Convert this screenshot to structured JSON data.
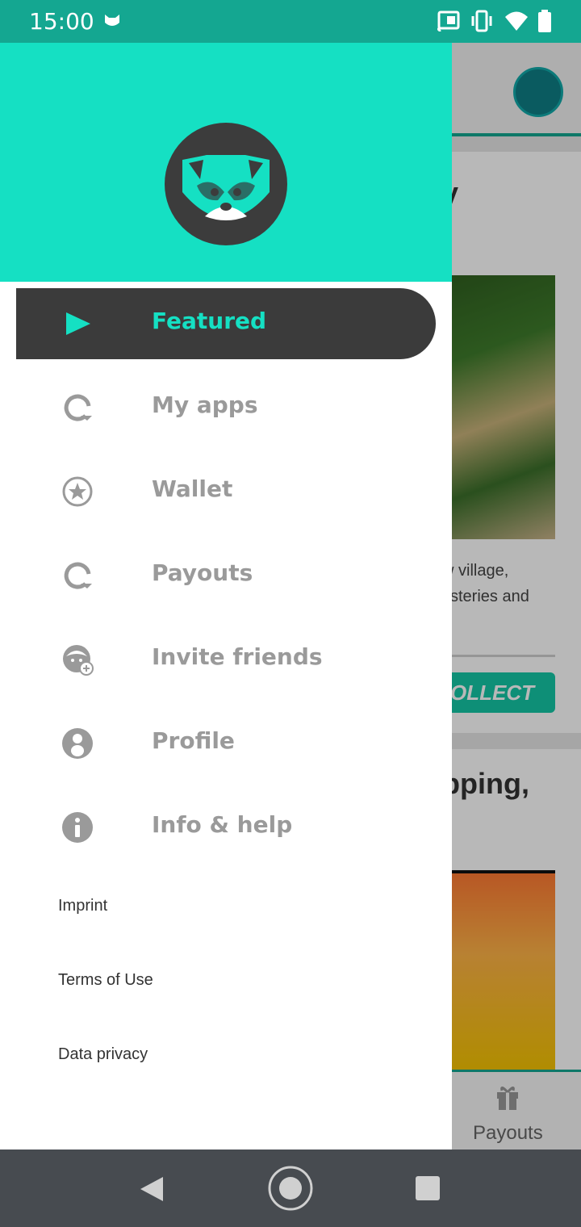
{
  "status_bar": {
    "time": "15:00"
  },
  "background": {
    "title_fragment_1": "y",
    "description_line_1": "w village,",
    "description_line_2": "ysteries and",
    "collect_button": "OLLECT",
    "title_fragment_2": "pping,",
    "bottom_tab_label": "Payouts"
  },
  "drawer": {
    "menu": [
      {
        "label": "Featured",
        "icon": "play-icon",
        "active": true
      },
      {
        "label": "My apps",
        "icon": "refresh-icon"
      },
      {
        "label": "Wallet",
        "icon": "star-circle-icon"
      },
      {
        "label": "Payouts",
        "icon": "refresh-icon"
      },
      {
        "label": "Invite friends",
        "icon": "face-plus-icon"
      },
      {
        "label": "Profile",
        "icon": "person-circle-icon"
      },
      {
        "label": "Info & help",
        "icon": "info-icon"
      }
    ],
    "links": [
      "Imprint",
      "Terms of Use",
      "Data privacy"
    ]
  },
  "colors": {
    "accent": "#15e0c3",
    "status_bar": "#14a791",
    "active_item_bg": "#3b3b3b",
    "inactive_text": "#9a9a9a",
    "nav_bar": "#474b50"
  }
}
